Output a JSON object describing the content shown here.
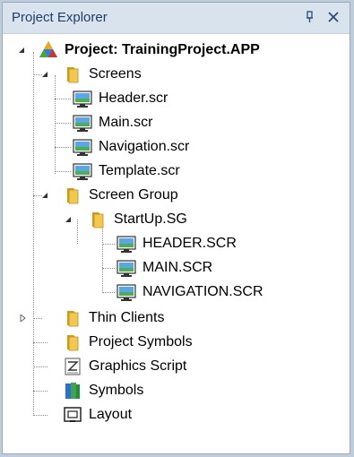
{
  "panel": {
    "title": "Project Explorer"
  },
  "tree": {
    "project": "Project: TrainingProject.APP",
    "screens": {
      "label": "Screens",
      "items": [
        "Header.scr",
        "Main.scr",
        "Navigation.scr",
        "Template.scr"
      ]
    },
    "screen_group": {
      "label": "Screen Group",
      "startup": {
        "label": "StartUp.SG",
        "items": [
          "HEADER.SCR",
          "MAIN.SCR",
          "NAVIGATION.SCR"
        ]
      }
    },
    "thin_clients": "Thin Clients",
    "project_symbols": "Project Symbols",
    "graphics_script": "Graphics Script",
    "symbols": "Symbols",
    "layout": "Layout"
  },
  "colors": {
    "title_bar": "#d9e3ee",
    "title_text": "#1f3f66",
    "folder": "#e8b535"
  }
}
